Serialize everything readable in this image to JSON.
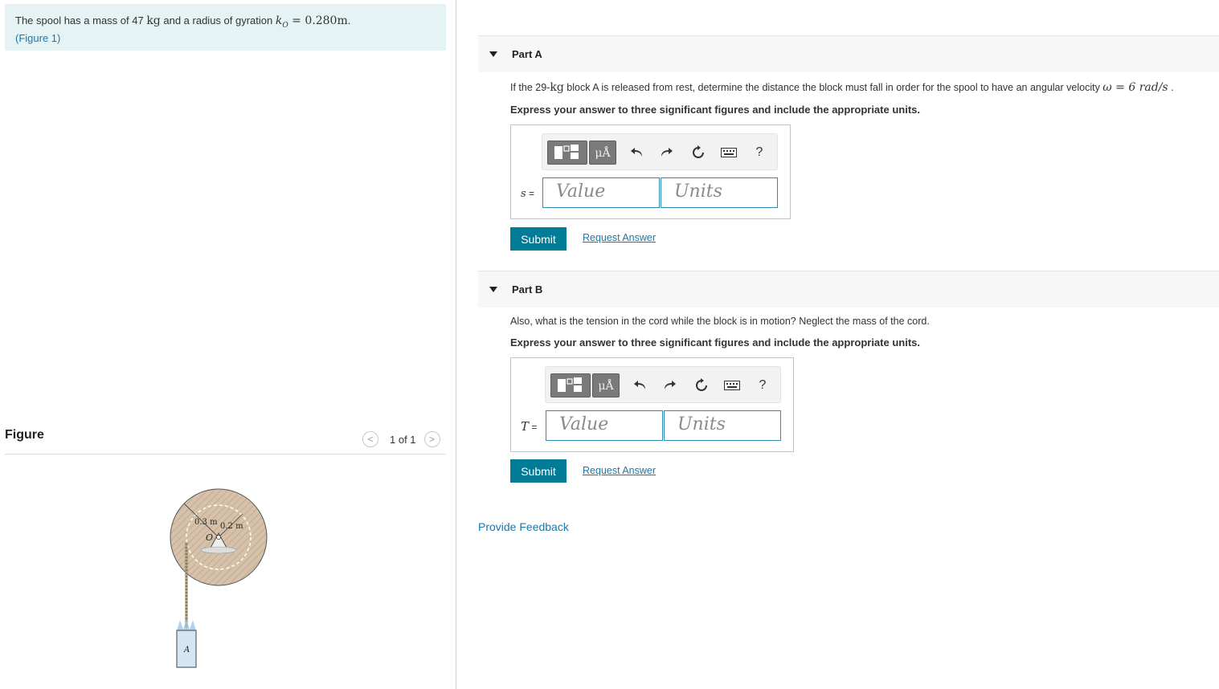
{
  "problem": {
    "text_before": "The spool has a mass of 47 ",
    "unit_kg": "kg",
    "text_mid": " and a radius of gyration ",
    "k_symbol": "k",
    "k_sub": "O",
    "k_eq": " = 0.280",
    "k_unit": "m",
    "k_end": ".",
    "figure_link": "(Figure 1)"
  },
  "figure_panel": {
    "title": "Figure",
    "pager_count": "1 of 1",
    "prev_glyph": "<",
    "next_glyph": ">",
    "labels": {
      "outer_radius": "0.3 m",
      "inner_radius": "0.2 m",
      "center": "O",
      "block": "A"
    }
  },
  "toolbar": {
    "units_glyph": "μÅ",
    "help_glyph": "?"
  },
  "part_a": {
    "header": "Part A",
    "question_1": "If the 29-",
    "question_kg": "kg",
    "question_2": " block A is released from rest, determine the distance the block must fall in order for the spool to have an angular velocity ",
    "question_omega": "ω = 6 rad/s",
    "question_3": " .",
    "instruction": "Express your answer to three significant figures and include the appropriate units.",
    "var_symbol": "s",
    "var_eq": " =",
    "value_placeholder": "Value",
    "units_placeholder": "Units",
    "submit_label": "Submit",
    "request_label": "Request Answer"
  },
  "part_b": {
    "header": "Part B",
    "question": "Also, what is the tension in the cord while the block is in motion? Neglect the mass of the cord.",
    "instruction": "Express your answer to three significant figures and include the appropriate units.",
    "var_symbol": "T",
    "var_eq": " =",
    "value_placeholder": "Value",
    "units_placeholder": "Units",
    "submit_label": "Submit",
    "request_label": "Request Answer"
  },
  "feedback_link": "Provide Feedback"
}
